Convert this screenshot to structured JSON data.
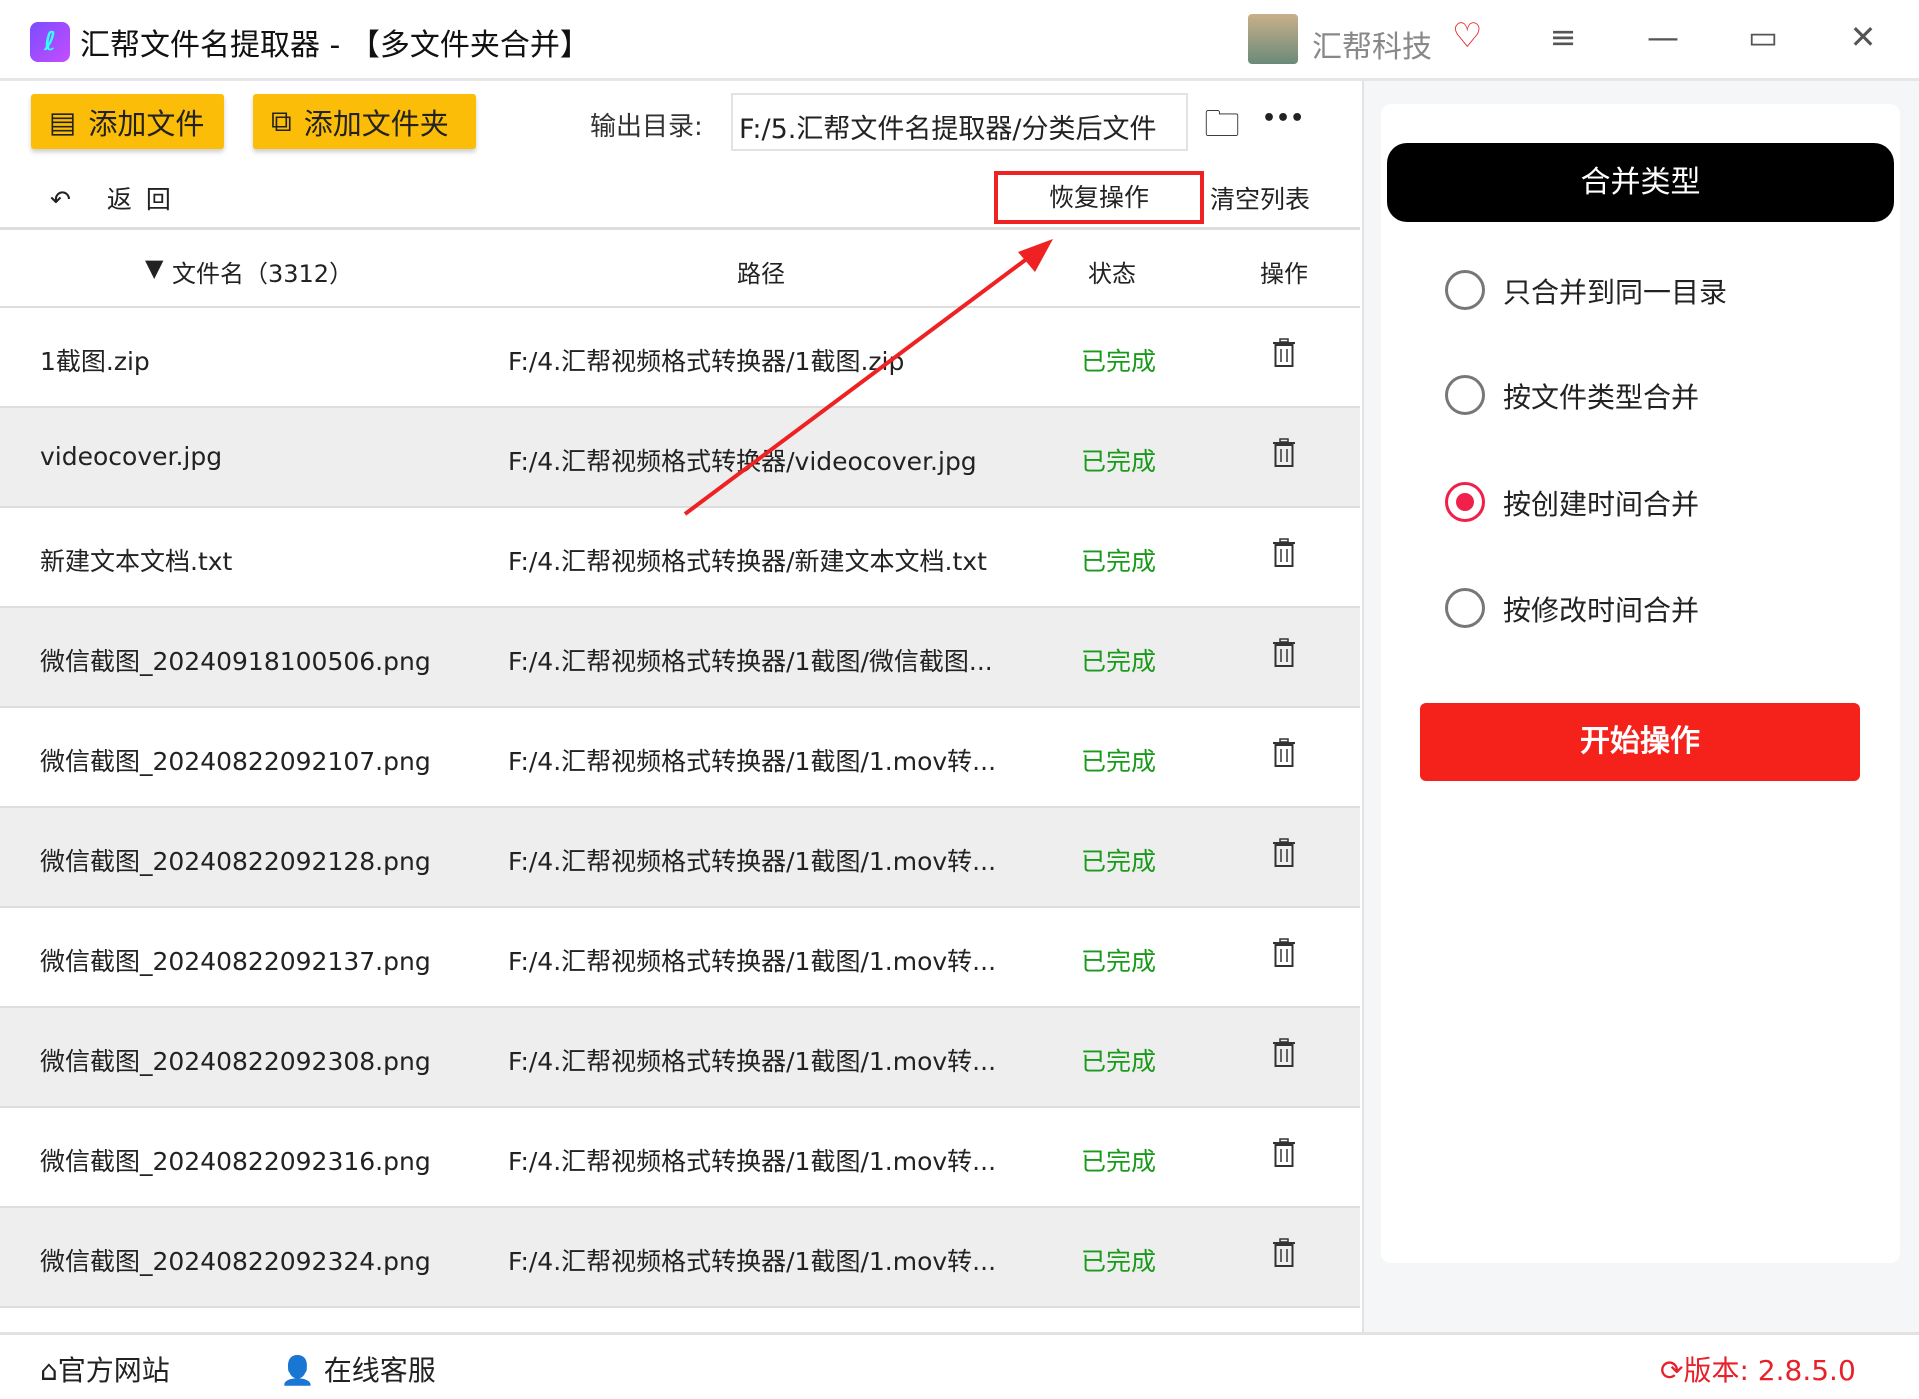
{
  "window": {
    "title": "汇帮文件名提取器 - 【多文件夹合并】",
    "brand": "汇帮科技",
    "controls": {
      "menu": "≡",
      "minimize": "—",
      "maximize": "▭",
      "close": "✕"
    }
  },
  "toolbar": {
    "add_file": "添加文件",
    "add_folder": "添加文件夹",
    "output_label": "输出目录:",
    "output_value": "F:/5.汇帮文件名提取器/分类后文件",
    "more": "•••"
  },
  "actions": {
    "back": "返回",
    "restore": "恢复操作",
    "clear": "清空列表"
  },
  "table": {
    "headers": {
      "name": "文件名（3312）",
      "path": "路径",
      "status": "状态",
      "op": "操作"
    },
    "rows": [
      {
        "name": "1截图.zip",
        "path": "F:/4.汇帮视频格式转换器/1截图.zip",
        "status": "已完成"
      },
      {
        "name": "videocover.jpg",
        "path": "F:/4.汇帮视频格式转换器/videocover.jpg",
        "status": "已完成"
      },
      {
        "name": "新建文本文档.txt",
        "path": "F:/4.汇帮视频格式转换器/新建文本文档.txt",
        "status": "已完成"
      },
      {
        "name": "微信截图_20240918100506.png",
        "path": "F:/4.汇帮视频格式转换器/1截图/微信截图...",
        "status": "已完成"
      },
      {
        "name": "微信截图_20240822092107.png",
        "path": "F:/4.汇帮视频格式转换器/1截图/1.mov转...",
        "status": "已完成"
      },
      {
        "name": "微信截图_20240822092128.png",
        "path": "F:/4.汇帮视频格式转换器/1截图/1.mov转...",
        "status": "已完成"
      },
      {
        "name": "微信截图_20240822092137.png",
        "path": "F:/4.汇帮视频格式转换器/1截图/1.mov转...",
        "status": "已完成"
      },
      {
        "name": "微信截图_20240822092308.png",
        "path": "F:/4.汇帮视频格式转换器/1截图/1.mov转...",
        "status": "已完成"
      },
      {
        "name": "微信截图_20240822092316.png",
        "path": "F:/4.汇帮视频格式转换器/1截图/1.mov转...",
        "status": "已完成"
      },
      {
        "name": "微信截图_20240822092324.png",
        "path": "F:/4.汇帮视频格式转换器/1截图/1.mov转...",
        "status": "已完成"
      }
    ]
  },
  "panel": {
    "title": "合并类型",
    "options": [
      "只合并到同一目录",
      "按文件类型合并",
      "按创建时间合并",
      "按修改时间合并"
    ],
    "selected_index": 2,
    "start": "开始操作"
  },
  "footer": {
    "website": "官方网站",
    "support": "在线客服",
    "version": "版本: 2.8.5.0"
  },
  "colors": {
    "accent_yellow": "#fbbd08",
    "start_red": "#f5221b",
    "status_green": "#1a9a1a",
    "radio_selected": "#f0204a",
    "annotation_red": "#ee2222"
  }
}
